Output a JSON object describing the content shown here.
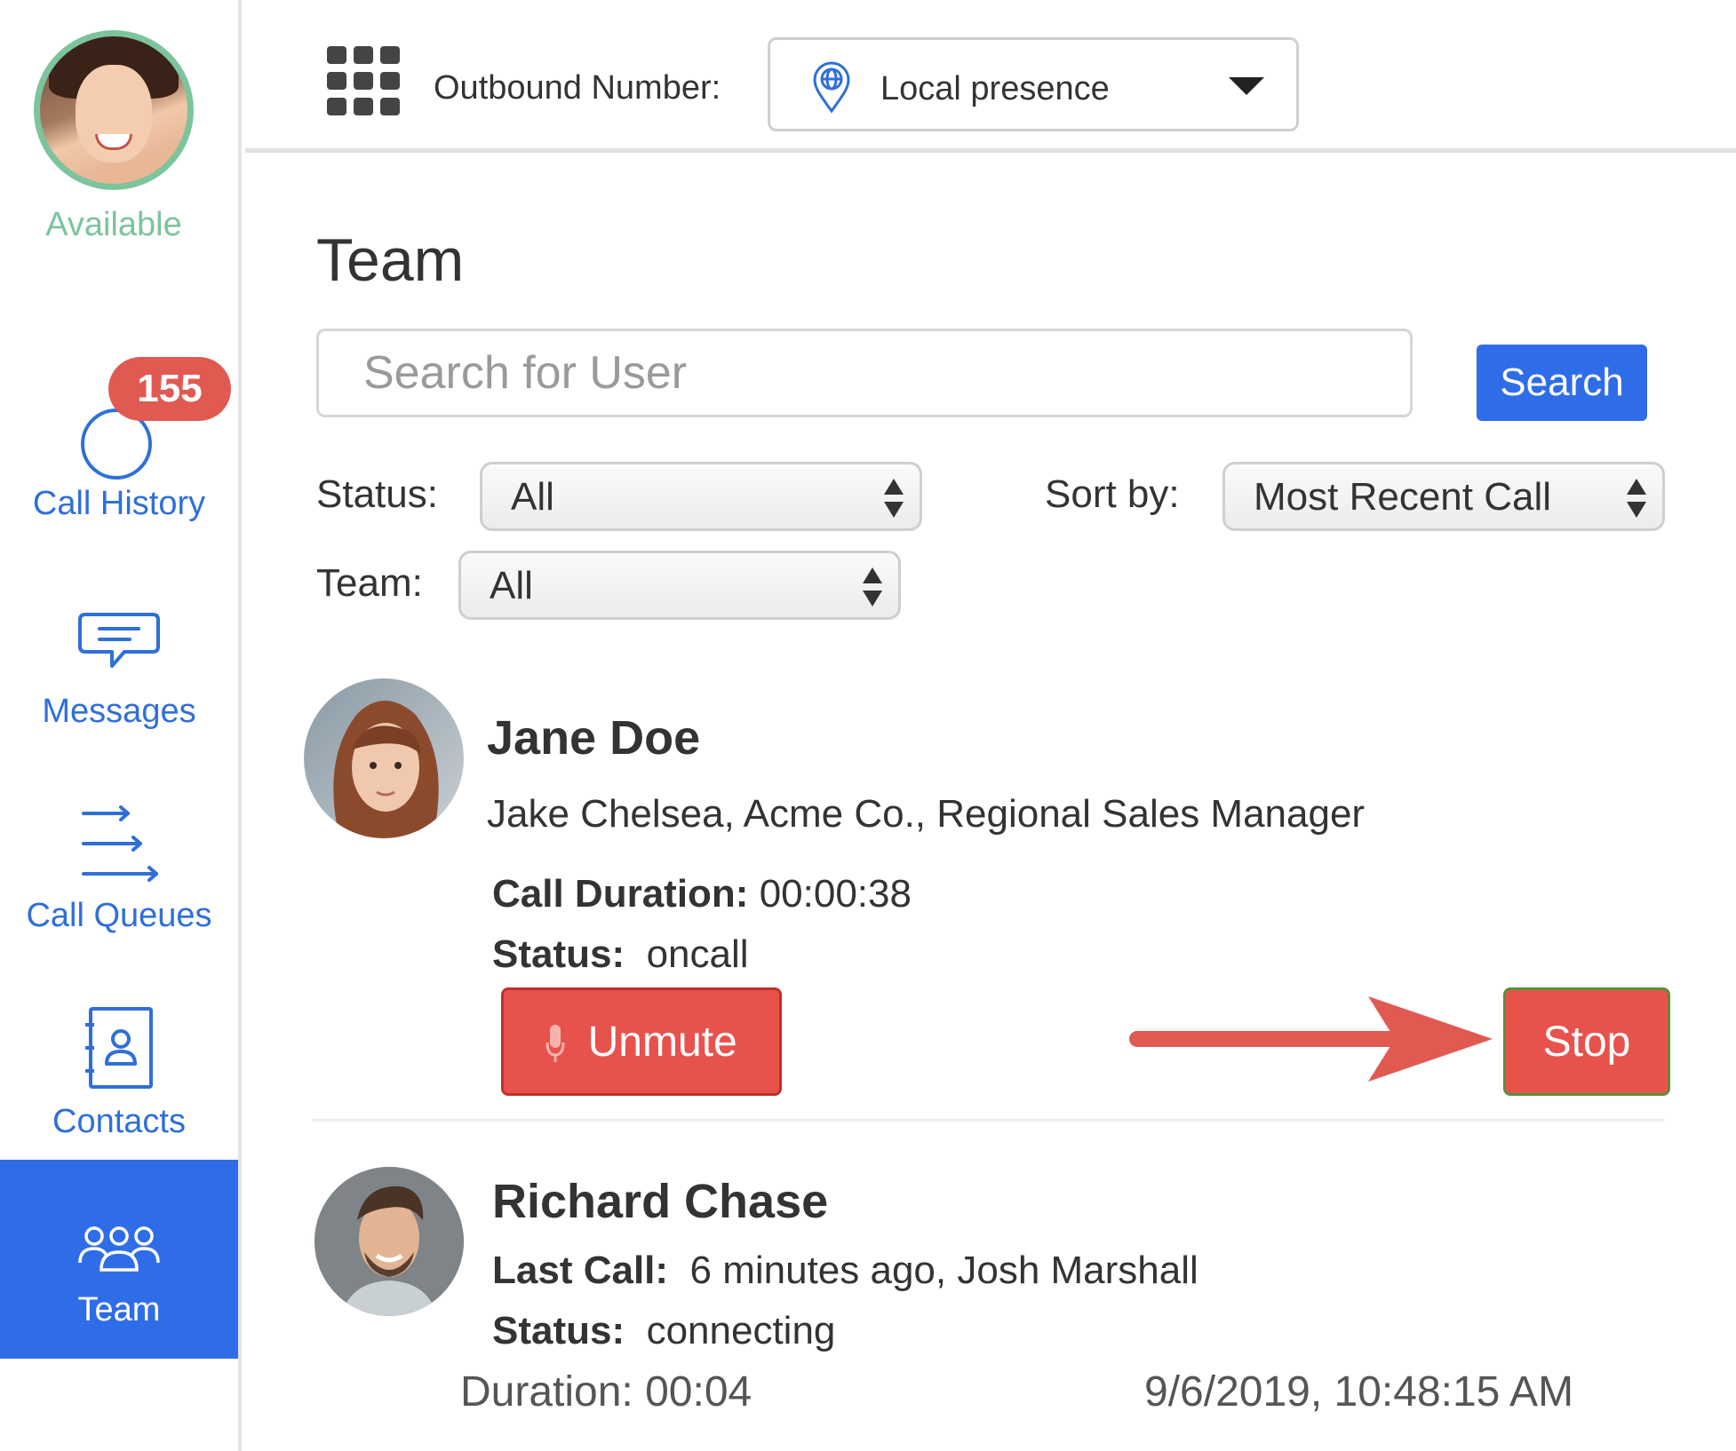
{
  "user": {
    "status": "Available",
    "status_color": "#7cc49c"
  },
  "sidebar": {
    "items": [
      {
        "label": "Call History",
        "icon": "call-history-icon",
        "badge": "155"
      },
      {
        "label": "Messages",
        "icon": "chat-bubble-icon"
      },
      {
        "label": "Call Queues",
        "icon": "queue-arrows-icon"
      },
      {
        "label": "Contacts",
        "icon": "contact-card-icon"
      },
      {
        "label": "Team",
        "icon": "team-icon",
        "active": true
      }
    ],
    "accent_color": "#2f6de8",
    "badge_color": "#e05a52"
  },
  "topbar": {
    "grid_icon": "dialpad-grid-icon",
    "outbound_label": "Outbound Number:",
    "outbound_value": "Local presence",
    "outbound_icon": "location-globe-icon"
  },
  "main": {
    "title": "Team",
    "search": {
      "placeholder": "Search for User",
      "button_label": "Search"
    },
    "filters": {
      "status_label": "Status:",
      "status_value": "All",
      "sort_label": "Sort by:",
      "sort_value": "Most Recent Call",
      "team_label": "Team:",
      "team_value": "All"
    },
    "members": [
      {
        "name": "Jane Doe",
        "detail": "Jake Chelsea, Acme Co., Regional Sales Manager",
        "duration_label": "Call Duration:",
        "duration_value": "00:00:38",
        "status_label": "Status:",
        "status_value": "oncall",
        "unmute_label": "Unmute",
        "stop_label": "Stop"
      },
      {
        "name": "Richard Chase",
        "last_call_label": "Last Call:",
        "last_call_value": "6 minutes ago, Josh Marshall",
        "status_label": "Status:",
        "status_value": "connecting"
      }
    ],
    "footer": {
      "duration": "Duration: 00:04",
      "timestamp": "9/6/2019, 10:48:15 AM"
    },
    "button_red": "#e8524c",
    "arrow_color": "#e05a52"
  }
}
